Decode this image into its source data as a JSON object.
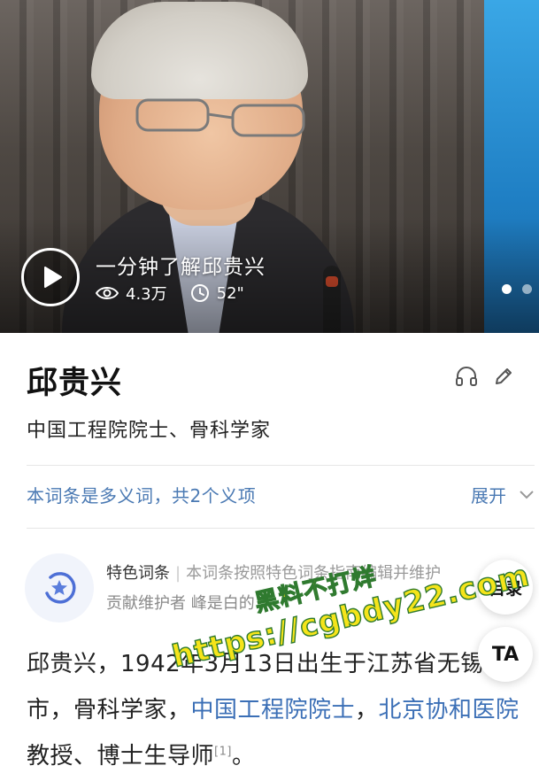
{
  "video": {
    "title": "一分钟了解邱贵兴",
    "views": "4.3万",
    "duration": "52\"",
    "carousel_count": 2,
    "carousel_active": 1
  },
  "entry": {
    "title": "邱贵兴",
    "subtitle": "中国工程院院士、骨科学家",
    "icons": [
      "headphones-icon",
      "pencil-icon"
    ]
  },
  "polysemy": {
    "text": "本词条是多义词，共2个义项",
    "expand_label": "展开"
  },
  "featured": {
    "label": "特色词条",
    "description": "本词条按照特色词条指南编辑并维护",
    "maintainer": "贡献维护者 峰是白的"
  },
  "floating": {
    "toc_label": "目录",
    "ta_label": "TA"
  },
  "body": {
    "text_1": "邱贵兴，1942年3月13日出生于江苏省无锡市，骨科学家，",
    "link_1": "中国工程院院士",
    "sep_1": "，",
    "link_2": "北京协和医院",
    "text_2": "教授、博士生导师",
    "ref": "[1]",
    "text_3": "。"
  },
  "watermark": {
    "line1": "黑料不打烊",
    "line2": "https://cgbdy22.com"
  },
  "colors": {
    "link": "#3b6fb6",
    "polysemy_link": "#4a79b3",
    "watermark_fill": "#f5e41a",
    "watermark_stroke": "#2f7a2f"
  }
}
